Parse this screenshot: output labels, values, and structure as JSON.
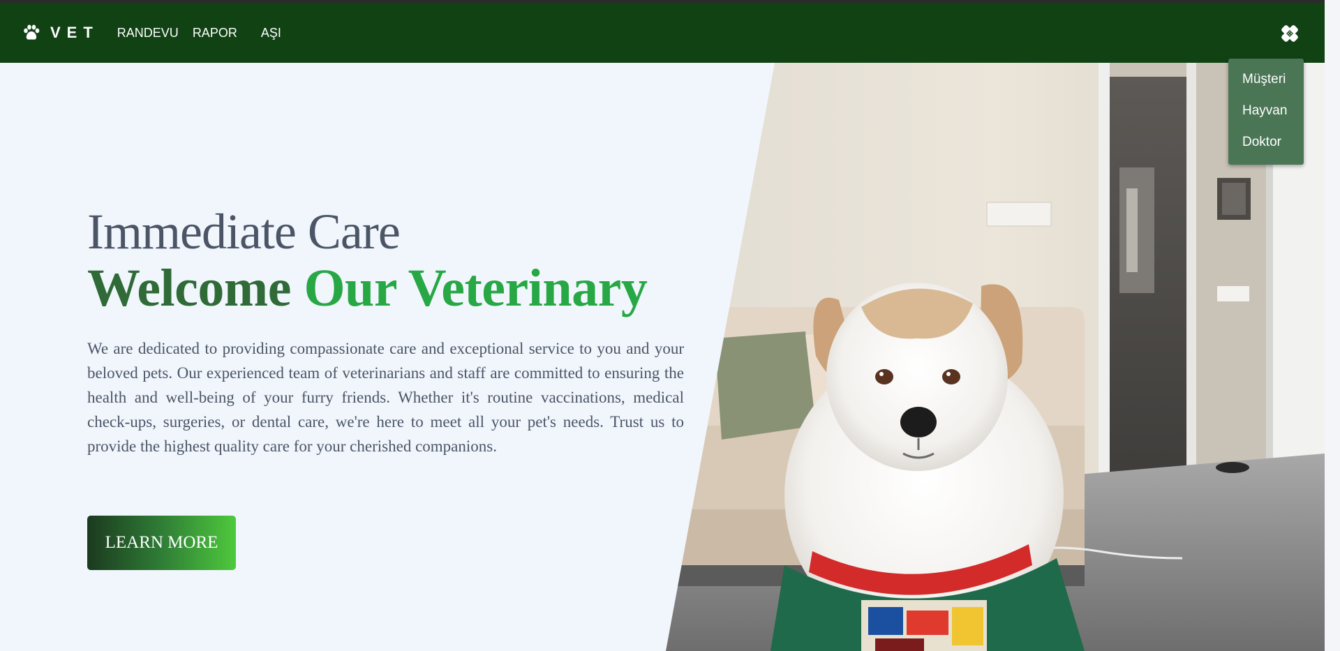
{
  "brand": {
    "name": "VET",
    "icon": "paw-icon"
  },
  "nav": {
    "links": [
      {
        "label": "RANDEVU"
      },
      {
        "label": "RAPOR"
      },
      {
        "label": "AŞI"
      }
    ],
    "menu_icon": "bandage-cross-icon"
  },
  "dropdown": {
    "items": [
      {
        "label": "Müşteri"
      },
      {
        "label": "Hayvan"
      },
      {
        "label": "Doktor"
      }
    ]
  },
  "hero": {
    "subtitle": "Immediate Care",
    "title_part1": "Welcome",
    "title_part2": "Our Veterinary",
    "description": "We are dedicated to providing compassionate care and exceptional service to you and your beloved pets. Our experienced team of veterinarians and staff are committed to ensuring the health and well-being of your furry friends. Whether it's routine vaccinations, medical check-ups, surgeries, or dental care, we're here to meet all your pet's needs. Trust us to provide the highest quality care for your cherished companions.",
    "button_label": "LEARN MORE",
    "image": "dog-photo"
  },
  "colors": {
    "navbar": "#114214",
    "accent_green": "#28a745",
    "dark_green": "#2f6a37",
    "dropdown_bg": "#4a7656",
    "page_bg": "#f1f6fd",
    "text_gray": "#4b5566"
  }
}
